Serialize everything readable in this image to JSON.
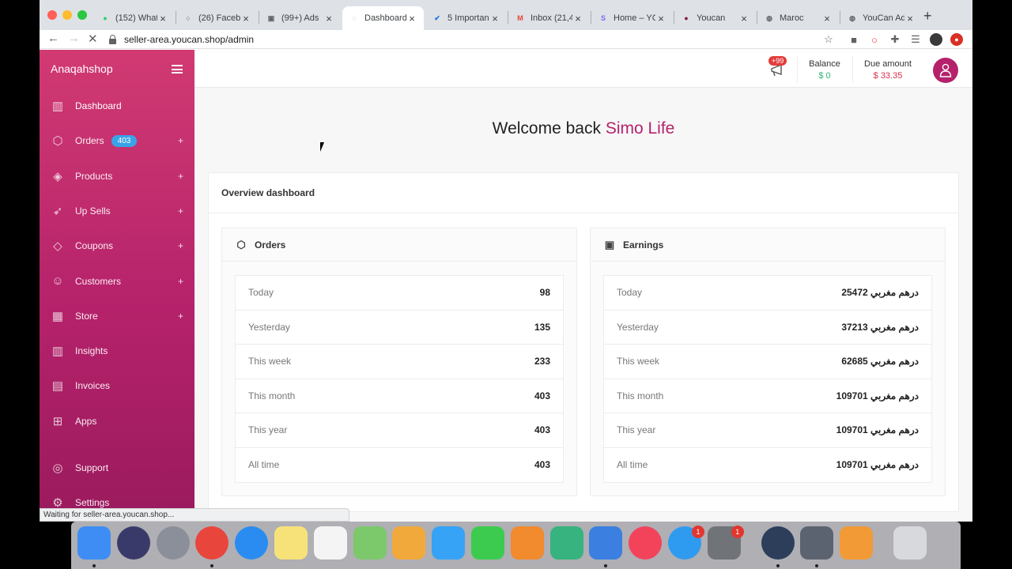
{
  "browser": {
    "tabs": [
      {
        "title": "(152) What",
        "fav_color": "#25d366",
        "fav_glyph": "●",
        "icon": "whatsapp-icon"
      },
      {
        "title": "(26) Faceb",
        "fav_color": "#5f6368",
        "fav_glyph": "○",
        "icon": "facebook-icon"
      },
      {
        "title": "(99+) Ads",
        "fav_color": "#5f6368",
        "fav_glyph": "▣",
        "icon": "ads-icon"
      },
      {
        "title": "Dashboard",
        "fav_color": "#9aa0a6",
        "fav_glyph": "◌",
        "icon": "loading-icon"
      },
      {
        "title": "5 Importan",
        "fav_color": "#1a73e8",
        "fav_glyph": "✔",
        "icon": "check-icon"
      },
      {
        "title": "Inbox (21,4",
        "fav_color": "#ea4335",
        "fav_glyph": "M",
        "icon": "gmail-icon"
      },
      {
        "title": "Home – YC",
        "fav_color": "#7b68ee",
        "fav_glyph": "S",
        "icon": "home-app-icon"
      },
      {
        "title": "Youcan",
        "fav_color": "#8a1a4a",
        "fav_glyph": "●",
        "icon": "youcan-icon"
      },
      {
        "title": "Maroc",
        "fav_color": "#5f6368",
        "fav_glyph": "◍",
        "icon": "globe-icon"
      },
      {
        "title": "YouCan Ad",
        "fav_color": "#5f6368",
        "fav_glyph": "◍",
        "icon": "globe-icon"
      }
    ],
    "active_tab": 3,
    "url": "seller-area.youcan.shop/admin",
    "status_text": "Waiting for seller-area.youcan.shop..."
  },
  "sidebar": {
    "brand": "Anaqahshop",
    "items": [
      {
        "label": "Dashboard",
        "icon": "bar-chart-icon",
        "glyph": "▥",
        "plus": false,
        "name": "dashboard"
      },
      {
        "label": "Orders",
        "icon": "box-icon",
        "glyph": "⬡",
        "plus": true,
        "badge": "403",
        "name": "orders"
      },
      {
        "label": "Products",
        "icon": "tag-icon",
        "glyph": "◈",
        "plus": true,
        "name": "products"
      },
      {
        "label": "Up Sells",
        "icon": "rocket-icon",
        "glyph": "➶",
        "plus": true,
        "name": "up-sells"
      },
      {
        "label": "Coupons",
        "icon": "coupon-icon",
        "glyph": "◇",
        "plus": true,
        "name": "coupons"
      },
      {
        "label": "Customers",
        "icon": "user-icon",
        "glyph": "☺",
        "plus": true,
        "name": "customers"
      },
      {
        "label": "Store",
        "icon": "store-icon",
        "glyph": "▦",
        "plus": true,
        "name": "store"
      },
      {
        "label": "Insights",
        "icon": "insights-icon",
        "glyph": "▥",
        "plus": false,
        "name": "insights"
      },
      {
        "label": "Invoices",
        "icon": "invoice-icon",
        "glyph": "▤",
        "plus": false,
        "name": "invoices"
      },
      {
        "label": "Apps",
        "icon": "apps-icon",
        "glyph": "⊞",
        "plus": false,
        "name": "apps"
      },
      {
        "label": "Support",
        "icon": "support-icon",
        "glyph": "◎",
        "plus": false,
        "name": "support"
      },
      {
        "label": "Settings",
        "icon": "gear-icon",
        "glyph": "⚙",
        "plus": false,
        "name": "settings"
      }
    ],
    "plus_glyph": "+"
  },
  "topbar": {
    "notif_count": "+99",
    "balance_label": "Balance",
    "balance_value": "$ 0",
    "balance_color": "#2bb673",
    "due_label": "Due amount",
    "due_value": "$ 33.35",
    "due_color": "#d9314b"
  },
  "welcome": {
    "prefix": "Welcome back",
    "name": "Simo Life"
  },
  "overview": {
    "title": "Overview dashboard",
    "orders": {
      "title": "Orders",
      "rows": [
        {
          "label": "Today",
          "value": "98"
        },
        {
          "label": "Yesterday",
          "value": "135"
        },
        {
          "label": "This week",
          "value": "233"
        },
        {
          "label": "This month",
          "value": "403"
        },
        {
          "label": "This year",
          "value": "403"
        },
        {
          "label": "All time",
          "value": "403"
        }
      ]
    },
    "earnings": {
      "title": "Earnings",
      "rows": [
        {
          "label": "Today",
          "value": "25472 درهم مغربي"
        },
        {
          "label": "Yesterday",
          "value": "37213 درهم مغربي"
        },
        {
          "label": "This week",
          "value": "62685 درهم مغربي"
        },
        {
          "label": "This month",
          "value": "109701 درهم مغربي"
        },
        {
          "label": "This year",
          "value": "109701 درهم مغربي"
        },
        {
          "label": "All time",
          "value": "109701 درهم مغربي"
        }
      ]
    }
  },
  "dock": {
    "apps": [
      {
        "name": "finder-icon",
        "color": "#3d8df5",
        "dot": true
      },
      {
        "name": "siri-icon",
        "color": "#3a3a6a"
      },
      {
        "name": "launchpad-icon",
        "color": "#8a8f99"
      },
      {
        "name": "chrome-icon",
        "color": "#e8453c",
        "dot": true
      },
      {
        "name": "safari-icon",
        "color": "#2a8cf0"
      },
      {
        "name": "notes-icon",
        "color": "#f7e27a"
      },
      {
        "name": "reminders-icon",
        "color": "#f4f4f4"
      },
      {
        "name": "maps-icon",
        "color": "#7cc96b"
      },
      {
        "name": "photos-icon",
        "color": "#f2a93b"
      },
      {
        "name": "messages-icon",
        "color": "#36a3f7"
      },
      {
        "name": "facetime-icon",
        "color": "#3ccb4e"
      },
      {
        "name": "pages-icon",
        "color": "#f28a2e"
      },
      {
        "name": "numbers-icon",
        "color": "#36b37e"
      },
      {
        "name": "keynote-icon",
        "color": "#3b7fe0",
        "dot": true
      },
      {
        "name": "music-icon",
        "color": "#f2435b"
      },
      {
        "name": "app-store-icon",
        "color": "#2e9bf0",
        "badge": "1"
      },
      {
        "name": "system-preferences-icon",
        "color": "#707378",
        "badge": "1"
      },
      {
        "name": "quicktime-icon",
        "color": "#2d3e5a",
        "dot": true
      },
      {
        "name": "utilities-icon",
        "color": "#5c6370",
        "dot": true
      },
      {
        "name": "calculator-icon",
        "color": "#f29a36"
      },
      {
        "name": "trash-icon",
        "color": "#d7d9dc"
      }
    ]
  }
}
